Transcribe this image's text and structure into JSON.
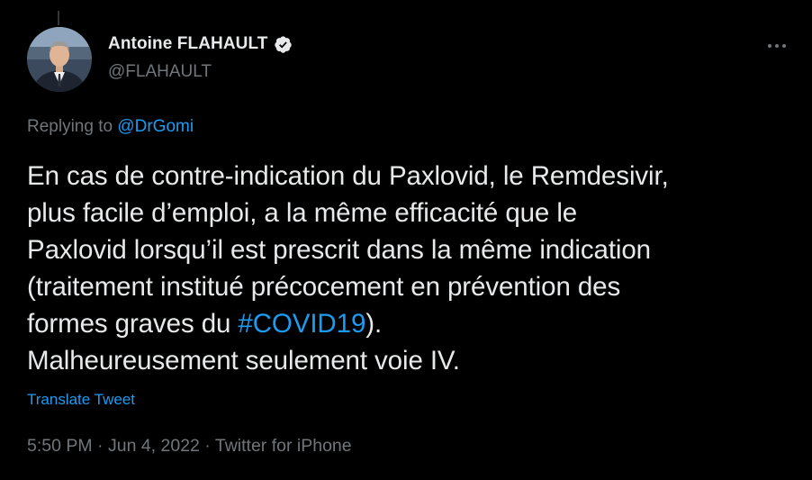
{
  "author": {
    "display_name": "Antoine FLAHAULT",
    "handle": "@FLAHAULT",
    "verified": true,
    "avatar_icon": "user-avatar"
  },
  "reply": {
    "prefix": "Replying to ",
    "mention": "@DrGomi"
  },
  "tweet": {
    "lines": [
      "En cas de contre-indication du Paxlovid, le Remdesivir,",
      "plus facile d’emploi, a la même efficacité que le",
      "Paxlovid lorsqu’il est prescrit dans la même indication",
      "(traitement institué précocement en prévention des"
    ],
    "line5_before": "formes graves du ",
    "hashtag": "#COVID19",
    "line5_after": ").",
    "line6": "Malheureusement seulement voie IV."
  },
  "translate_label": "Translate Tweet",
  "meta": {
    "time": "5:50 PM",
    "separator": " · ",
    "date": "Jun 4, 2022",
    "source": "Twitter for iPhone"
  },
  "icons": {
    "verified": "verified-badge-icon",
    "more": "more-options-icon"
  },
  "colors": {
    "background": "#000000",
    "text": "#e7e9ea",
    "muted": "#71767b",
    "accent": "#1d9bf0"
  }
}
